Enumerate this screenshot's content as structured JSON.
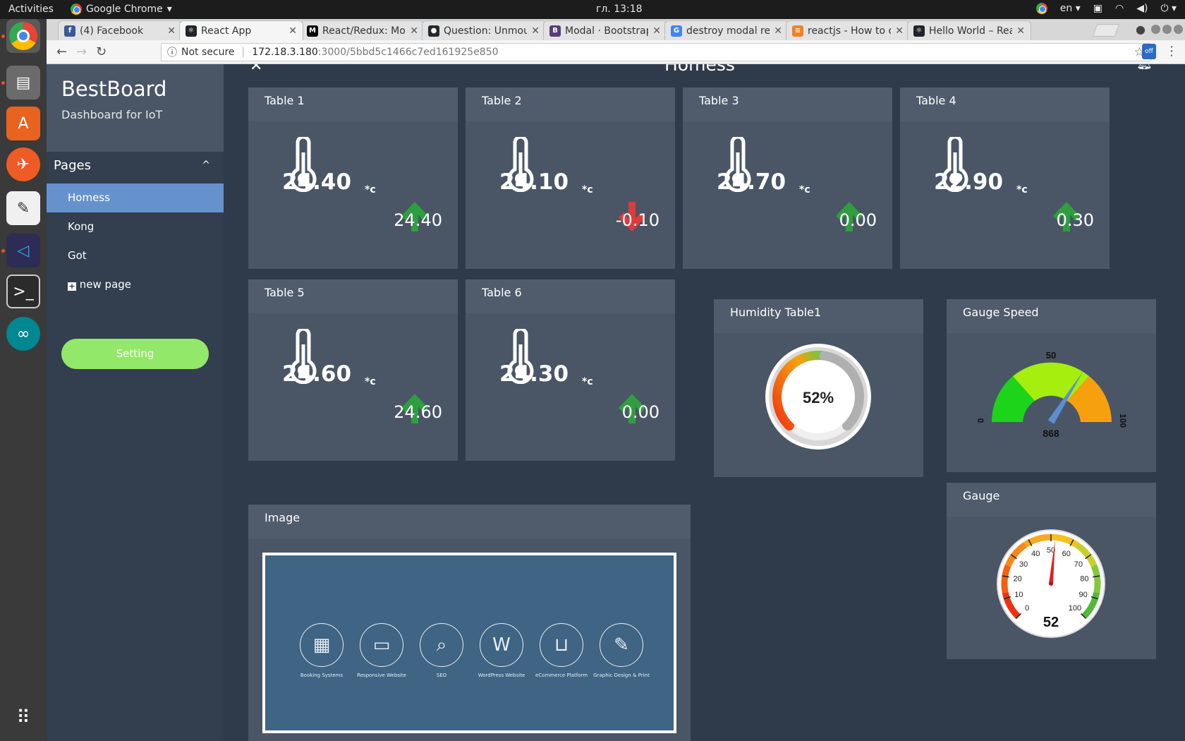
{
  "system": {
    "activities": "Activities",
    "app_name": "Google Chrome",
    "clock": "гл. 13:18",
    "lang": "en"
  },
  "tabs": [
    {
      "label": "(4) Facebook",
      "favicon": "facebook-icon",
      "color": "#3b5998",
      "glyph": "f"
    },
    {
      "label": "React App",
      "favicon": "react-icon",
      "color": "#20232a",
      "glyph": "⚛"
    },
    {
      "label": "React/Redux: Mod",
      "favicon": "medium-icon",
      "color": "#000000",
      "glyph": "M"
    },
    {
      "label": "Question: Unmou",
      "favicon": "github-icon",
      "color": "#24292e",
      "glyph": "●"
    },
    {
      "label": "Modal · Bootstrap",
      "favicon": "bootstrap-icon",
      "color": "#563d7c",
      "glyph": "B"
    },
    {
      "label": "destroy modal rea",
      "favicon": "google-icon",
      "color": "#4285f4",
      "glyph": "G"
    },
    {
      "label": "reactjs - How to o",
      "favicon": "stackoverflow-icon",
      "color": "#f48024",
      "glyph": "≡"
    },
    {
      "label": "Hello World – Rea",
      "favicon": "react-icon",
      "color": "#20232a",
      "glyph": "⚛"
    }
  ],
  "address": {
    "security": "Not secure",
    "host": "172.18.3.180",
    "path": ":3000/5bbd5c1466c7ed161925e850"
  },
  "brand": {
    "title": "BestBoard",
    "subtitle": "Dashboard for IoT"
  },
  "sidebar": {
    "section": "Pages",
    "items": [
      {
        "label": "Homess",
        "active": true
      },
      {
        "label": "Kong"
      },
      {
        "label": "Got"
      },
      {
        "label": "new page"
      }
    ],
    "setting": "Setting"
  },
  "page_title": "Homess",
  "tables": [
    {
      "title": "Table 1",
      "value": "24.40",
      "unit": "*c",
      "delta": "24.40",
      "trend": "up"
    },
    {
      "title": "Table 2",
      "value": "24.10",
      "unit": "*c",
      "delta": "-0.10",
      "trend": "down"
    },
    {
      "title": "Table 3",
      "value": "24.70",
      "unit": "*c",
      "delta": "0.00",
      "trend": "up"
    },
    {
      "title": "Table 4",
      "value": "22.90",
      "unit": "*c",
      "delta": "0.30",
      "trend": "up"
    },
    {
      "title": "Table 5",
      "value": "24.60",
      "unit": "*c",
      "delta": "24.60",
      "trend": "up"
    },
    {
      "title": "Table 6",
      "value": "24.30",
      "unit": "*c",
      "delta": "0.00",
      "trend": "up"
    }
  ],
  "humidity": {
    "title": "Humidity Table1",
    "label": "52%",
    "value": 52
  },
  "gauge_speed": {
    "title": "Gauge Speed",
    "min": "0",
    "mid": "50",
    "max": "100",
    "reading": "868",
    "needle_value": 68
  },
  "gauge": {
    "title": "Gauge",
    "value": 52,
    "label": "52",
    "ticks": [
      "0",
      "10",
      "20",
      "30",
      "40",
      "50",
      "60",
      "70",
      "80",
      "90",
      "100"
    ]
  },
  "image_card": {
    "title": "Image",
    "services": [
      {
        "label": "Booking Systems",
        "icon": "calendar-icon",
        "glyph": "▦"
      },
      {
        "label": "Responsive Website",
        "icon": "devices-icon",
        "glyph": "▭"
      },
      {
        "label": "SEO",
        "icon": "magnifier-icon",
        "glyph": "⌕"
      },
      {
        "label": "WordPress Website",
        "icon": "wordpress-icon",
        "glyph": "W"
      },
      {
        "label": "eCommerce Platform",
        "icon": "basket-icon",
        "glyph": "⊔"
      },
      {
        "label": "Graphic Design & Print",
        "icon": "pencil-icon",
        "glyph": "✎"
      }
    ]
  },
  "colors": {
    "up": "#2e9e3e",
    "down": "#e03a3a",
    "accent": "#6592cc",
    "setting": "#92e868"
  }
}
